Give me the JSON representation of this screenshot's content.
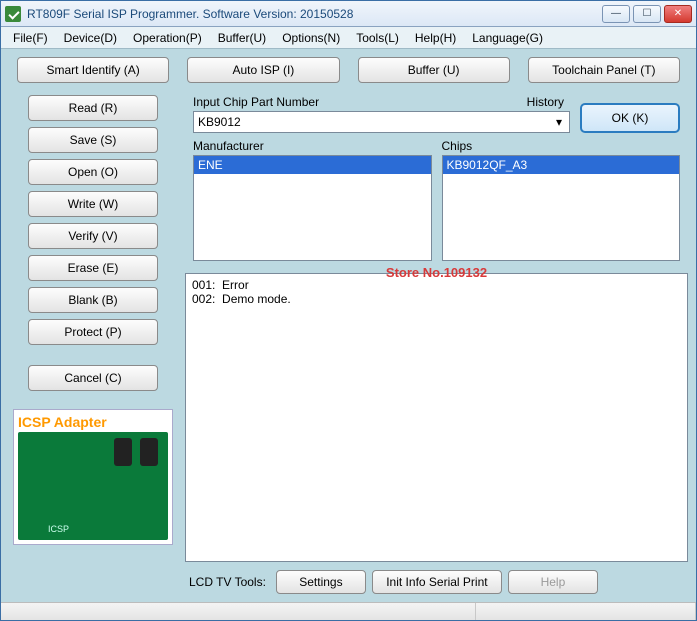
{
  "window": {
    "title": "RT809F Serial ISP Programmer. Software Version: 20150528"
  },
  "menu": {
    "file": "File(F)",
    "device": "Device(D)",
    "operation": "Operation(P)",
    "buffer": "Buffer(U)",
    "options": "Options(N)",
    "tools": "Tools(L)",
    "help": "Help(H)",
    "language": "Language(G)"
  },
  "topbuttons": {
    "smart": "Smart Identify (A)",
    "autoisp": "Auto ISP (I)",
    "buffer": "Buffer (U)",
    "toolchain": "Toolchain Panel (T)"
  },
  "sidebuttons": {
    "read": "Read (R)",
    "save": "Save (S)",
    "open": "Open (O)",
    "write": "Write  (W)",
    "verify": "Verify (V)",
    "erase": "Erase (E)",
    "blank": "Blank (B)",
    "protect": "Protect (P)",
    "cancel": "Cancel (C)"
  },
  "adapter_label": "ICSP Adapter",
  "chip": {
    "input_label": "Input Chip Part Number",
    "history_label": "History",
    "value": "KB9012",
    "ok": "OK (K)",
    "manufacturer_label": "Manufacturer",
    "chips_label": "Chips",
    "manufacturer_selected": "ENE",
    "chip_selected": "KB9012QF_A3"
  },
  "watermark": "Store No.109132",
  "log": "001:  Error\n002:  Demo mode.",
  "bottom": {
    "lcd_label": "LCD TV Tools:",
    "settings": "Settings",
    "init": "Init Info Serial Print",
    "help": "Help"
  }
}
